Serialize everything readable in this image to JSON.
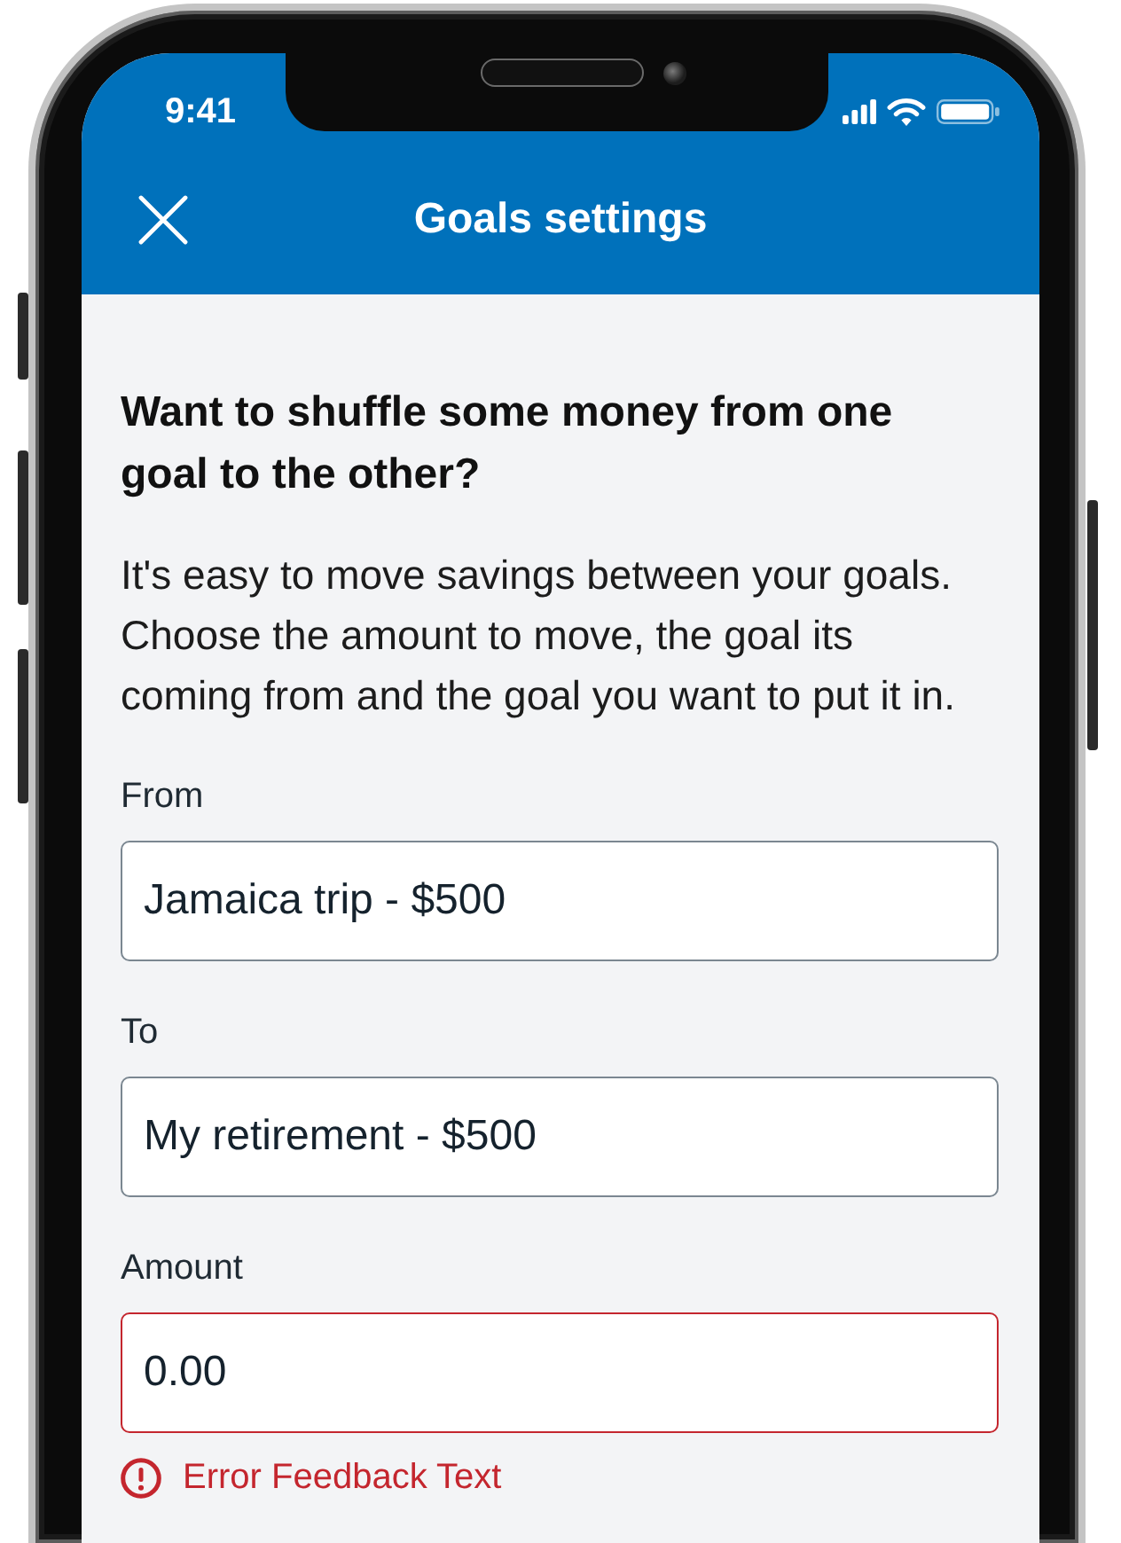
{
  "status_bar": {
    "time": "9:41"
  },
  "header": {
    "title": "Goals settings"
  },
  "intro": {
    "heading": "Want to shuffle some money from one goal to the other?",
    "body": "It's easy to move savings between your goals. Choose the amount to move, the goal its coming from and the goal you want to put it in."
  },
  "fields": [
    {
      "label": "From",
      "value": "Jamaica trip - $500",
      "error": false
    },
    {
      "label": "To",
      "value": "My retirement - $500",
      "error": false
    },
    {
      "label": "Amount",
      "value": "0.00",
      "error": true,
      "error_text": "Error Feedback Text"
    }
  ]
}
